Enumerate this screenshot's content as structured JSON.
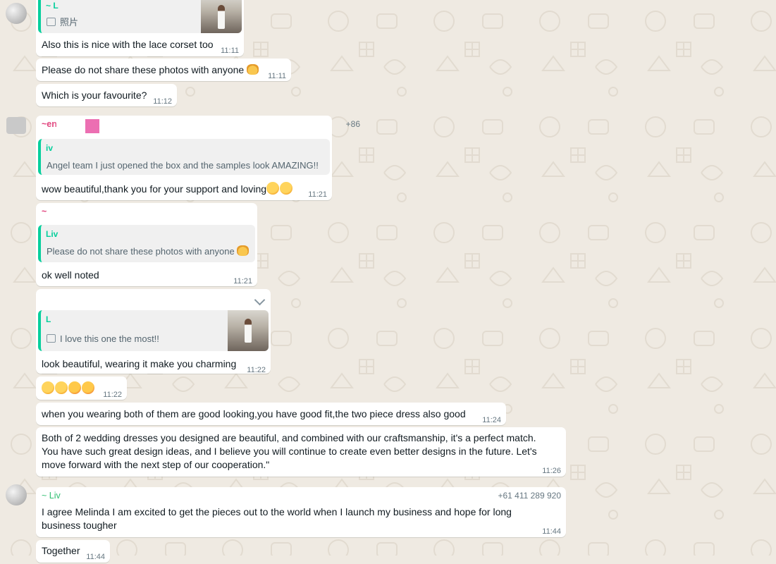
{
  "colors": {
    "chat_background": "#efeae2",
    "bubble": "#ffffff",
    "quote_bar": "#06cf9c",
    "sender_pink": "#e1457e",
    "sender_green": "#2fbf71",
    "timestamp": "#667781"
  },
  "messages": [
    {
      "id": "m0",
      "quote": {
        "name": "~ L",
        "text": "照片",
        "icon": "image-icon",
        "has_photo": true
      },
      "text": "Also this is nice with the lace corset too",
      "time": "11:11"
    },
    {
      "id": "m1",
      "text": "Please do not share these photos with anyone",
      "emoji": "heart-hands-emoji",
      "time": "11:11"
    },
    {
      "id": "m2",
      "text": "Which is your favourite?",
      "time": "11:12"
    },
    {
      "id": "m3",
      "sender": "~en",
      "phone": "+86",
      "quote": {
        "name": "iv",
        "text": "Angel team I just opened the box and the samples look AMAZING!!"
      },
      "text": "wow beautiful,thank you for your support and loving",
      "emoji": "smiling-face-with-hearts-emoji",
      "time": "11:21"
    },
    {
      "id": "m4",
      "sender": "~",
      "quote": {
        "name": "Liv",
        "text": "Please do not share these photos with anyone",
        "emoji": "heart-hands-emoji"
      },
      "text": "ok well noted",
      "time": "11:21"
    },
    {
      "id": "m5",
      "quote": {
        "name": "L",
        "text": "I love this one the most!!",
        "icon": "image-icon",
        "has_photo": true
      },
      "text": "look beautiful, wearing it make you charming",
      "time": "11:22"
    },
    {
      "id": "m6",
      "text": "",
      "emoji": "partying-face-emoji kissing-face-emoji",
      "time": "11:22"
    },
    {
      "id": "m7",
      "text": "when you wearing both of them are good looking,you have good fit,the two piece dress also good",
      "time": "11:24"
    },
    {
      "id": "m8",
      "text": "Both of 2 wedding dresses you designed are beautiful, and combined with our craftsmanship, it's a perfect match. You have such great design ideas, and I believe you will continue to create even better designs in the future. Let's move forward with the next step of our cooperation.\"",
      "time": "11:26"
    },
    {
      "id": "m9",
      "sender": "~ Liv",
      "phone": "+61 411 289 920",
      "text": "I agree Melinda I am excited to get the pieces out to the world when I launch my business and hope for long business tougher",
      "time": "11:44"
    },
    {
      "id": "m10",
      "text": "Together",
      "time": "11:44"
    }
  ]
}
